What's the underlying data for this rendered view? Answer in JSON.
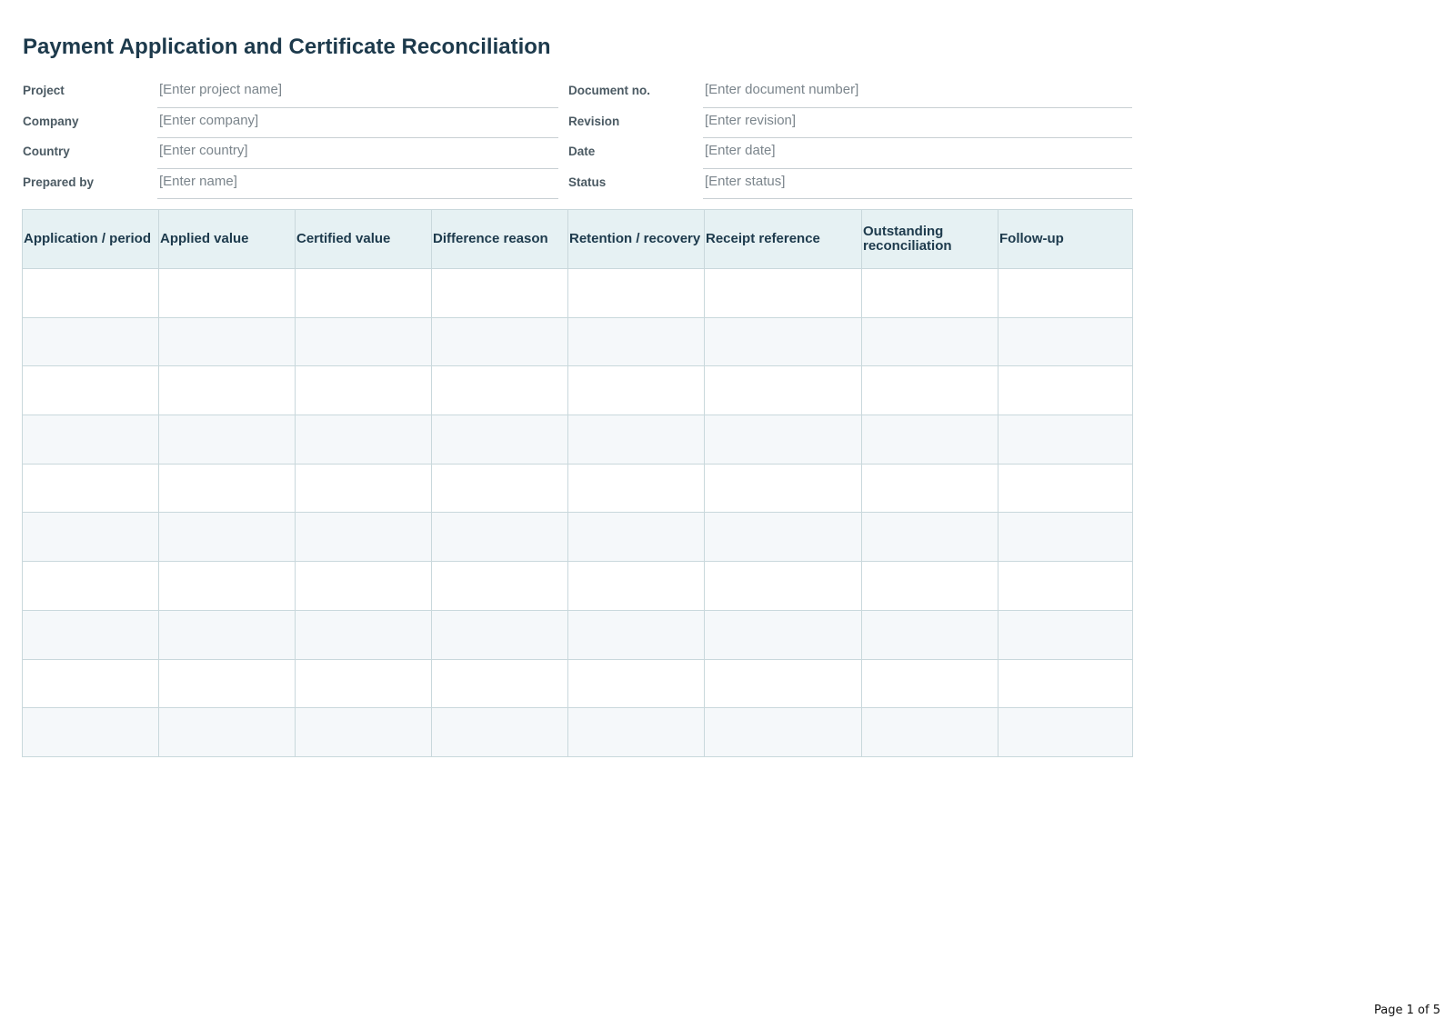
{
  "document": {
    "title": "Payment Application and Certificate Reconciliation"
  },
  "meta": {
    "left": [
      {
        "label": "Project",
        "value": "[Enter project name]"
      },
      {
        "label": "Company",
        "value": "[Enter company]"
      },
      {
        "label": "Country",
        "value": "[Enter country]"
      },
      {
        "label": "Prepared by",
        "value": "[Enter name]"
      }
    ],
    "right": [
      {
        "label": "Document no.",
        "value": "[Enter document number]"
      },
      {
        "label": "Revision",
        "value": "[Enter revision]"
      },
      {
        "label": "Date",
        "value": "[Enter date]"
      },
      {
        "label": "Status",
        "value": "[Enter status]"
      }
    ]
  },
  "table": {
    "headers": [
      "Application / period",
      "Applied value",
      "Certified value",
      "Difference reason",
      "Retention / recovery",
      "Receipt reference",
      "Outstanding reconciliation",
      "Follow-up"
    ],
    "empty_row_count": 10
  },
  "footer": {
    "page_label": "Page 1 of 5"
  }
}
